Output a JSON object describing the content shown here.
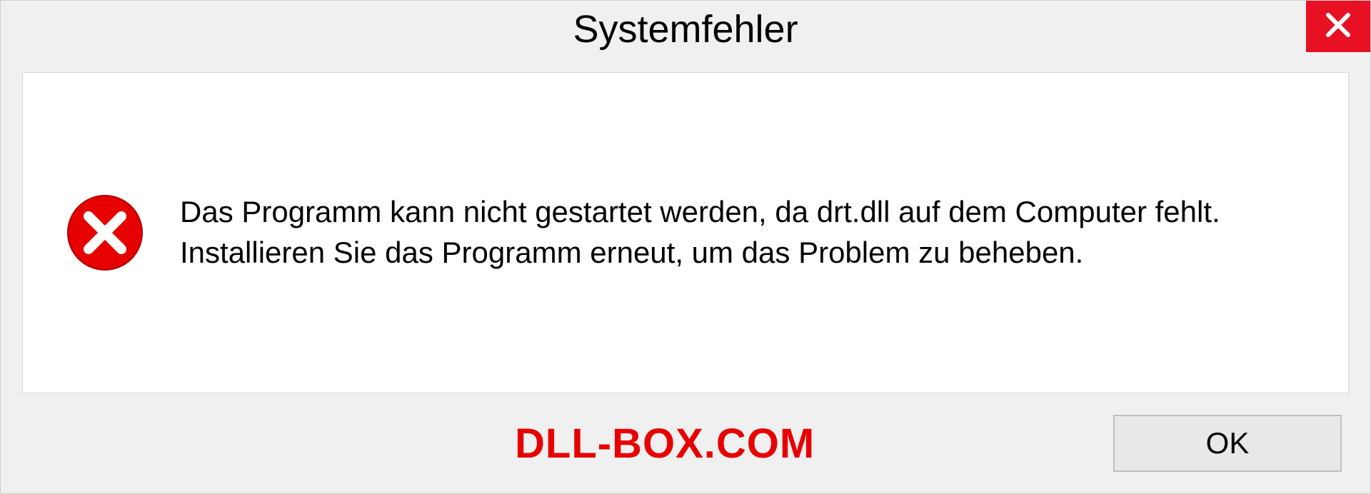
{
  "dialog": {
    "title": "Systemfehler",
    "message": "Das Programm kann nicht gestartet werden, da drt.dll auf dem Computer fehlt. Installieren Sie das Programm erneut, um das Problem zu beheben.",
    "ok_label": "OK"
  },
  "watermark": "DLL-BOX.COM",
  "colors": {
    "close_bg": "#e81123",
    "error_red": "#e60000",
    "watermark_red": "#e60000"
  }
}
